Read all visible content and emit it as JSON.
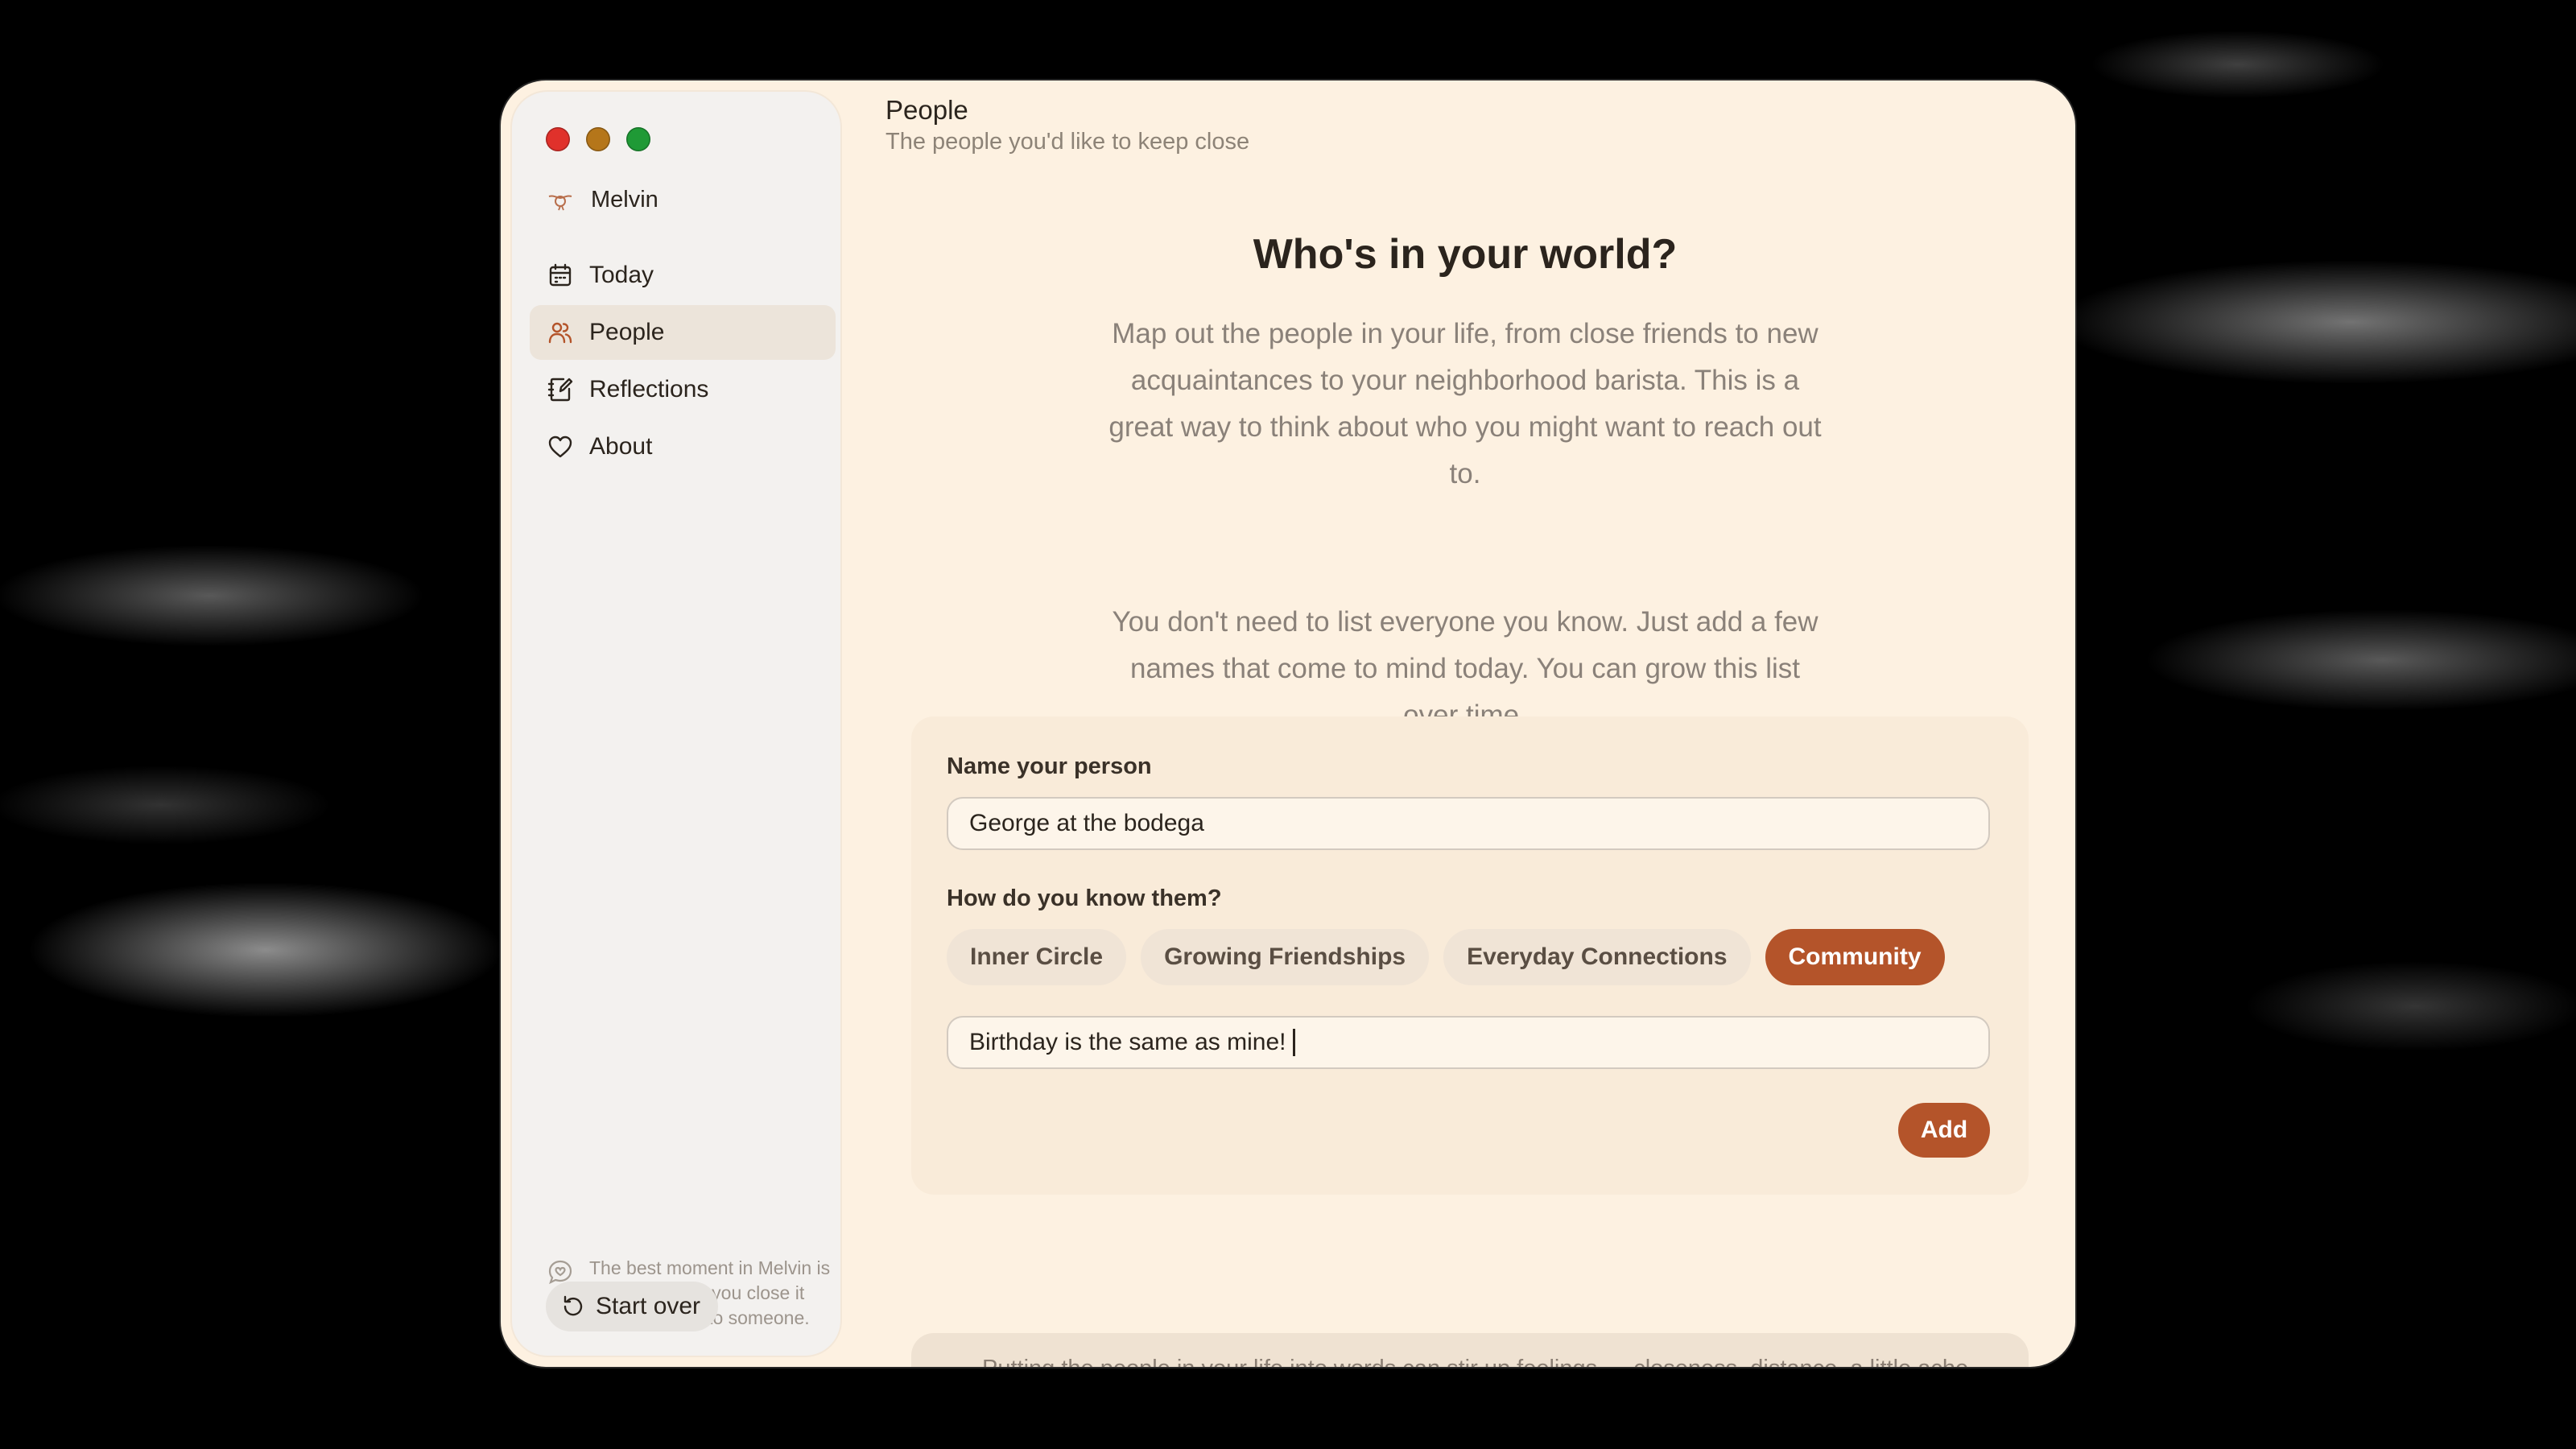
{
  "app": {
    "name": "Melvin"
  },
  "sidebar": {
    "items": [
      {
        "label": "Today",
        "icon": "calendar-icon",
        "active": false
      },
      {
        "label": "People",
        "icon": "people-icon",
        "active": true
      },
      {
        "label": "Reflections",
        "icon": "journal-icon",
        "active": false
      },
      {
        "label": "About",
        "icon": "heart-icon",
        "active": false
      }
    ],
    "note": "The best moment in Melvin is the one where you close it and reach out to someone.",
    "start_over_label": "Start over"
  },
  "header": {
    "title": "People",
    "subtitle": "The people you'd like to keep close"
  },
  "hero": {
    "title": "Who's in your world?",
    "paragraph1": "Map out the people in your life, from close friends to new acquaintances to your neighborhood barista. This is a great way to think about who you might want to reach out to.",
    "paragraph2": "You don't need to list everyone you know. Just add a few names that come to mind today. You can grow this list over time."
  },
  "form": {
    "name_label": "Name your person",
    "name_value": "George at the bodega",
    "relation_label": "How do you know them?",
    "categories": [
      {
        "label": "Inner Circle",
        "selected": false
      },
      {
        "label": "Growing Friendships",
        "selected": false
      },
      {
        "label": "Everyday Connections",
        "selected": false
      },
      {
        "label": "Community",
        "selected": true
      }
    ],
    "note_value": "Birthday is the same as mine!",
    "add_label": "Add"
  },
  "footer_note": {
    "text": "Putting the people in your life into words can stir up feelings — closeness, distance, a little ache here and there. That's normal. Relationships drift and change over time, and that's part of it too. There's no right way to fill this in."
  },
  "colors": {
    "accent": "#b4542a",
    "window_bg": "#fdf1e1",
    "sidebar_bg": "#f3f1ef"
  }
}
